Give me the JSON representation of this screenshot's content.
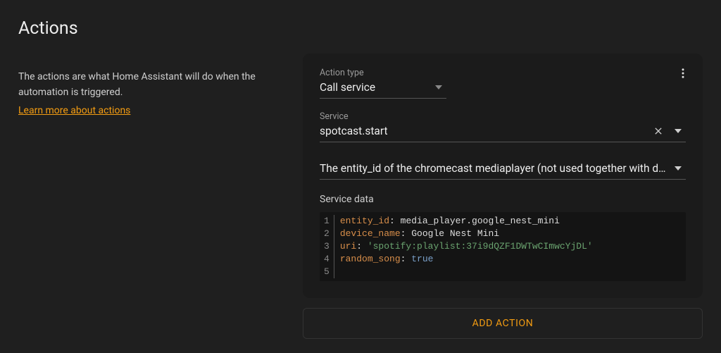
{
  "header": {
    "title": "Actions"
  },
  "info": {
    "description": "The actions are what Home Assistant will do when the automation is triggered.",
    "learn_more": "Learn more about actions"
  },
  "action": {
    "action_type": {
      "label": "Action type",
      "value": "Call service"
    },
    "service": {
      "label": "Service",
      "value": "spotcast.start"
    },
    "entity_hint": "The entity_id of the chromecast mediaplayer (not used together with devic…",
    "service_data_label": "Service data",
    "code": {
      "lines": {
        "l1": {
          "key": "entity_id",
          "val": "media_player.google_nest_mini"
        },
        "l2": {
          "key": "device_name",
          "val": "Google Nest Mini"
        },
        "l3": {
          "key": "uri",
          "val": "'spotify:playlist:37i9dQZF1DWTwCImwcYjDL'"
        },
        "l4": {
          "key": "random_song",
          "val": "true"
        }
      }
    }
  },
  "add_action_label": "ADD ACTION"
}
